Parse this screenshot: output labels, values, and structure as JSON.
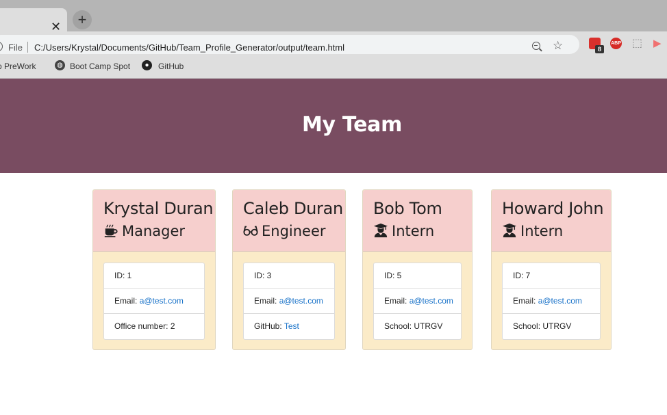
{
  "browser": {
    "url": "C:/Users/Krystal/Documents/GitHub/Team_Profile_Generator/output/team.html",
    "file_label": "File",
    "extension_badge": "8",
    "abp_label": "ABP",
    "bookmarks": [
      "mp PreWork",
      "Boot Camp Spot",
      "GitHub"
    ]
  },
  "page": {
    "title": "My Team"
  },
  "team": [
    {
      "name": "Krystal Duran",
      "role": "Manager",
      "role_icon": "coffee-icon",
      "id_label": "ID: 1",
      "email_label": "Email: ",
      "email": "a@test.com",
      "extra_label": "Office number: 2",
      "extra_link": ""
    },
    {
      "name": "Caleb Duran",
      "role": "Engineer",
      "role_icon": "glasses-icon",
      "id_label": "ID: 3",
      "email_label": "Email: ",
      "email": "a@test.com",
      "extra_label": "GitHub: ",
      "extra_link": "Test"
    },
    {
      "name": "Bob Tom",
      "role": "Intern",
      "role_icon": "graduate-icon",
      "id_label": "ID: 5",
      "email_label": "Email: ",
      "email": "a@test.com",
      "extra_label": "School: UTRGV",
      "extra_link": ""
    },
    {
      "name": "Howard John",
      "role": "Intern",
      "role_icon": "graduate-icon",
      "id_label": "ID: 7",
      "email_label": "Email: ",
      "email": "a@test.com",
      "extra_label": "School: UTRGV",
      "extra_link": ""
    }
  ],
  "colors": {
    "header_bg": "#794c61",
    "card_head_bg": "#f6cfcd",
    "card_body_bg": "#fbebc8",
    "link": "#1a73c9"
  }
}
